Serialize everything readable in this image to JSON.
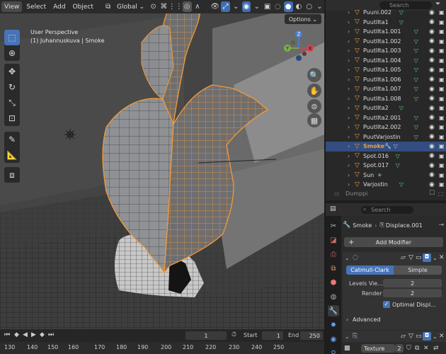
{
  "header": {
    "menus": [
      "View",
      "Select",
      "Add",
      "Object"
    ],
    "orientation": "Global",
    "options_label": "Options"
  },
  "viewport": {
    "view_name": "User Perspective",
    "object_info": "(1) Juhannuskuva | Smoke"
  },
  "gizmo": {
    "z": "Z",
    "y": "Y",
    "x": "X"
  },
  "toolbar_tools": [
    "select-box",
    "cursor",
    "move",
    "rotate",
    "scale",
    "transform",
    "annotate",
    "measure",
    "add-cube"
  ],
  "outliner": {
    "search_placeholder": "Search",
    "rows": [
      {
        "name": "Puuni.002",
        "mod": "lamp"
      },
      {
        "name": "PuutIlta1",
        "mod": "tri"
      },
      {
        "name": "PuutIlta1.001",
        "mod": "tri"
      },
      {
        "name": "PuutIlta1.002",
        "mod": "tri"
      },
      {
        "name": "PuutIlta1.003",
        "mod": "tri"
      },
      {
        "name": "PuutIlta1.004",
        "mod": "tri"
      },
      {
        "name": "PuutIlta1.005",
        "mod": "tri"
      },
      {
        "name": "PuutIlta1.006",
        "mod": "tri"
      },
      {
        "name": "PuutIlta1.007",
        "mod": "tri"
      },
      {
        "name": "PuutIlta1.008",
        "mod": "tri"
      },
      {
        "name": "PuutIlta2",
        "mod": "tri"
      },
      {
        "name": "PuutIlta2.001",
        "mod": "tri"
      },
      {
        "name": "PuutIlta2.002",
        "mod": "tri"
      },
      {
        "name": "PuutVarjostin",
        "mod": "tri"
      },
      {
        "name": "Smoke",
        "mod": "wrench-tri",
        "selected": true
      },
      {
        "name": "Spot.016",
        "mod": "lamp"
      },
      {
        "name": "Spot.017",
        "mod": "lamp"
      },
      {
        "name": "Sun",
        "mod": "sun"
      },
      {
        "name": "Varjostin",
        "mod": "tri"
      }
    ],
    "footer_item": "Dumppi"
  },
  "properties": {
    "search_placeholder": "Search",
    "breadcrumb_object": "Smoke",
    "breadcrumb_modifier": "Displace.001",
    "add_modifier_label": "Add Modifier",
    "subdiv": {
      "mode_active": "Catmull-Clark",
      "mode_other": "Simple",
      "levels_viewport_label": "Levels Vie...",
      "levels_viewport_value": "2",
      "render_label": "Render",
      "render_value": "2",
      "optimal_display_label": "Optimal Displ...",
      "advanced_label": "Advanced"
    },
    "texture_label": "Texture",
    "texture_users": "2"
  },
  "timeline": {
    "current_frame": "1",
    "start_label": "Start",
    "start_value": "1",
    "end_label": "End",
    "end_value": "250",
    "ruler_ticks": [
      "130",
      "140",
      "150",
      "160",
      "170",
      "180",
      "190",
      "200",
      "210",
      "220",
      "230",
      "240",
      "250"
    ]
  },
  "colors": {
    "accent": "#4774b8",
    "selection_outline": "#f29a38",
    "modifier_green": "#6fcf82",
    "object_orange": "#e69a3e"
  }
}
